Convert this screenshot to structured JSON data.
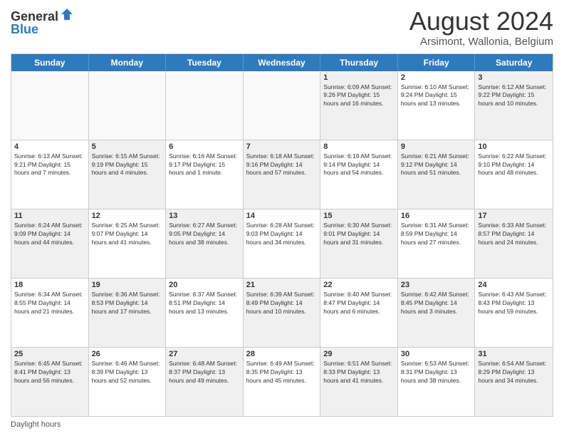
{
  "logo": {
    "general": "General",
    "blue": "Blue"
  },
  "title": "August 2024",
  "location": "Arsimont, Wallonia, Belgium",
  "days_of_week": [
    "Sunday",
    "Monday",
    "Tuesday",
    "Wednesday",
    "Thursday",
    "Friday",
    "Saturday"
  ],
  "footer": "Daylight hours",
  "weeks": [
    [
      {
        "day": "",
        "info": "",
        "empty": true
      },
      {
        "day": "",
        "info": "",
        "empty": true
      },
      {
        "day": "",
        "info": "",
        "empty": true
      },
      {
        "day": "",
        "info": "",
        "empty": true
      },
      {
        "day": "1",
        "info": "Sunrise: 6:09 AM\nSunset: 9:26 PM\nDaylight: 15 hours\nand 16 minutes.",
        "shaded": true
      },
      {
        "day": "2",
        "info": "Sunrise: 6:10 AM\nSunset: 9:24 PM\nDaylight: 15 hours\nand 13 minutes.",
        "shaded": false
      },
      {
        "day": "3",
        "info": "Sunrise: 6:12 AM\nSunset: 9:22 PM\nDaylight: 15 hours\nand 10 minutes.",
        "shaded": true
      }
    ],
    [
      {
        "day": "4",
        "info": "Sunrise: 6:13 AM\nSunset: 9:21 PM\nDaylight: 15 hours\nand 7 minutes.",
        "shaded": false
      },
      {
        "day": "5",
        "info": "Sunrise: 6:15 AM\nSunset: 9:19 PM\nDaylight: 15 hours\nand 4 minutes.",
        "shaded": true
      },
      {
        "day": "6",
        "info": "Sunrise: 6:16 AM\nSunset: 9:17 PM\nDaylight: 15 hours\nand 1 minute.",
        "shaded": false
      },
      {
        "day": "7",
        "info": "Sunrise: 6:18 AM\nSunset: 9:16 PM\nDaylight: 14 hours\nand 57 minutes.",
        "shaded": true
      },
      {
        "day": "8",
        "info": "Sunrise: 6:19 AM\nSunset: 9:14 PM\nDaylight: 14 hours\nand 54 minutes.",
        "shaded": false
      },
      {
        "day": "9",
        "info": "Sunrise: 6:21 AM\nSunset: 9:12 PM\nDaylight: 14 hours\nand 51 minutes.",
        "shaded": true
      },
      {
        "day": "10",
        "info": "Sunrise: 6:22 AM\nSunset: 9:10 PM\nDaylight: 14 hours\nand 48 minutes.",
        "shaded": false
      }
    ],
    [
      {
        "day": "11",
        "info": "Sunrise: 6:24 AM\nSunset: 9:09 PM\nDaylight: 14 hours\nand 44 minutes.",
        "shaded": true
      },
      {
        "day": "12",
        "info": "Sunrise: 6:25 AM\nSunset: 9:07 PM\nDaylight: 14 hours\nand 41 minutes.",
        "shaded": false
      },
      {
        "day": "13",
        "info": "Sunrise: 6:27 AM\nSunset: 9:05 PM\nDaylight: 14 hours\nand 38 minutes.",
        "shaded": true
      },
      {
        "day": "14",
        "info": "Sunrise: 6:28 AM\nSunset: 9:03 PM\nDaylight: 14 hours\nand 34 minutes.",
        "shaded": false
      },
      {
        "day": "15",
        "info": "Sunrise: 6:30 AM\nSunset: 9:01 PM\nDaylight: 14 hours\nand 31 minutes.",
        "shaded": true
      },
      {
        "day": "16",
        "info": "Sunrise: 6:31 AM\nSunset: 8:59 PM\nDaylight: 14 hours\nand 27 minutes.",
        "shaded": false
      },
      {
        "day": "17",
        "info": "Sunrise: 6:33 AM\nSunset: 8:57 PM\nDaylight: 14 hours\nand 24 minutes.",
        "shaded": true
      }
    ],
    [
      {
        "day": "18",
        "info": "Sunrise: 6:34 AM\nSunset: 8:55 PM\nDaylight: 14 hours\nand 21 minutes.",
        "shaded": false
      },
      {
        "day": "19",
        "info": "Sunrise: 6:36 AM\nSunset: 8:53 PM\nDaylight: 14 hours\nand 17 minutes.",
        "shaded": true
      },
      {
        "day": "20",
        "info": "Sunrise: 6:37 AM\nSunset: 8:51 PM\nDaylight: 14 hours\nand 13 minutes.",
        "shaded": false
      },
      {
        "day": "21",
        "info": "Sunrise: 6:39 AM\nSunset: 8:49 PM\nDaylight: 14 hours\nand 10 minutes.",
        "shaded": true
      },
      {
        "day": "22",
        "info": "Sunrise: 6:40 AM\nSunset: 8:47 PM\nDaylight: 14 hours\nand 6 minutes.",
        "shaded": false
      },
      {
        "day": "23",
        "info": "Sunrise: 6:42 AM\nSunset: 8:45 PM\nDaylight: 14 hours\nand 3 minutes.",
        "shaded": true
      },
      {
        "day": "24",
        "info": "Sunrise: 6:43 AM\nSunset: 8:43 PM\nDaylight: 13 hours\nand 59 minutes.",
        "shaded": false
      }
    ],
    [
      {
        "day": "25",
        "info": "Sunrise: 6:45 AM\nSunset: 8:41 PM\nDaylight: 13 hours\nand 56 minutes.",
        "shaded": true
      },
      {
        "day": "26",
        "info": "Sunrise: 6:46 AM\nSunset: 8:39 PM\nDaylight: 13 hours\nand 52 minutes.",
        "shaded": false
      },
      {
        "day": "27",
        "info": "Sunrise: 6:48 AM\nSunset: 8:37 PM\nDaylight: 13 hours\nand 49 minutes.",
        "shaded": true
      },
      {
        "day": "28",
        "info": "Sunrise: 6:49 AM\nSunset: 8:35 PM\nDaylight: 13 hours\nand 45 minutes.",
        "shaded": false
      },
      {
        "day": "29",
        "info": "Sunrise: 6:51 AM\nSunset: 8:33 PM\nDaylight: 13 hours\nand 41 minutes.",
        "shaded": true
      },
      {
        "day": "30",
        "info": "Sunrise: 6:53 AM\nSunset: 8:31 PM\nDaylight: 13 hours\nand 38 minutes.",
        "shaded": false
      },
      {
        "day": "31",
        "info": "Sunrise: 6:54 AM\nSunset: 8:29 PM\nDaylight: 13 hours\nand 34 minutes.",
        "shaded": true
      }
    ]
  ]
}
